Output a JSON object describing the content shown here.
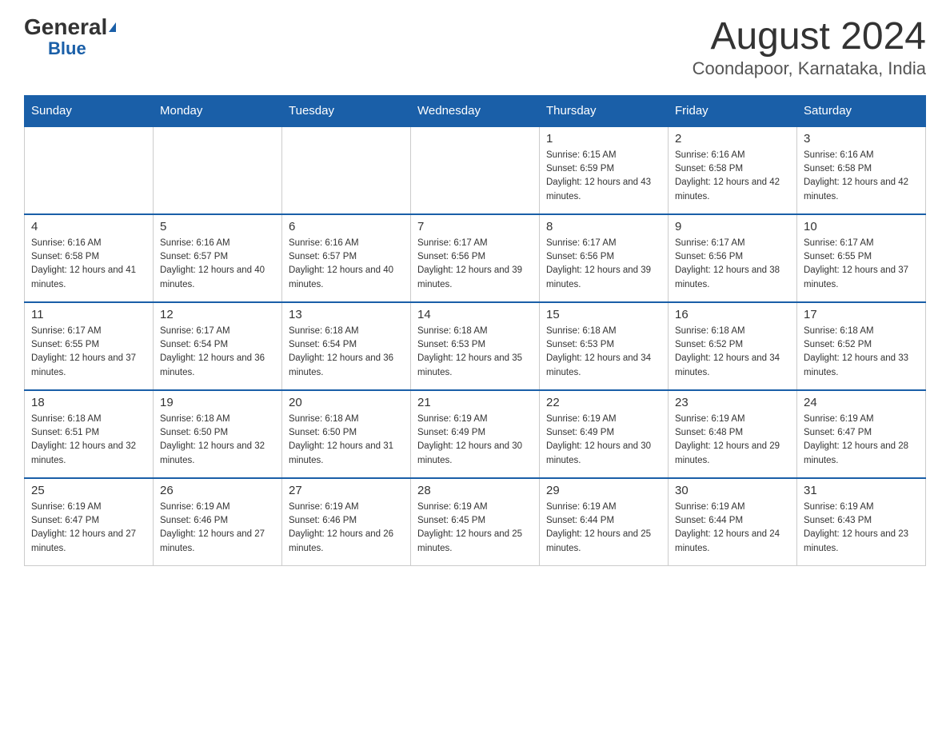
{
  "logo": {
    "general": "General",
    "triangle": "",
    "blue": "Blue"
  },
  "title": "August 2024",
  "subtitle": "Coondapoor, Karnataka, India",
  "days_of_week": [
    "Sunday",
    "Monday",
    "Tuesday",
    "Wednesday",
    "Thursday",
    "Friday",
    "Saturday"
  ],
  "weeks": [
    [
      {
        "day": "",
        "sunrise": "",
        "sunset": "",
        "daylight": ""
      },
      {
        "day": "",
        "sunrise": "",
        "sunset": "",
        "daylight": ""
      },
      {
        "day": "",
        "sunrise": "",
        "sunset": "",
        "daylight": ""
      },
      {
        "day": "",
        "sunrise": "",
        "sunset": "",
        "daylight": ""
      },
      {
        "day": "1",
        "sunrise": "Sunrise: 6:15 AM",
        "sunset": "Sunset: 6:59 PM",
        "daylight": "Daylight: 12 hours and 43 minutes."
      },
      {
        "day": "2",
        "sunrise": "Sunrise: 6:16 AM",
        "sunset": "Sunset: 6:58 PM",
        "daylight": "Daylight: 12 hours and 42 minutes."
      },
      {
        "day": "3",
        "sunrise": "Sunrise: 6:16 AM",
        "sunset": "Sunset: 6:58 PM",
        "daylight": "Daylight: 12 hours and 42 minutes."
      }
    ],
    [
      {
        "day": "4",
        "sunrise": "Sunrise: 6:16 AM",
        "sunset": "Sunset: 6:58 PM",
        "daylight": "Daylight: 12 hours and 41 minutes."
      },
      {
        "day": "5",
        "sunrise": "Sunrise: 6:16 AM",
        "sunset": "Sunset: 6:57 PM",
        "daylight": "Daylight: 12 hours and 40 minutes."
      },
      {
        "day": "6",
        "sunrise": "Sunrise: 6:16 AM",
        "sunset": "Sunset: 6:57 PM",
        "daylight": "Daylight: 12 hours and 40 minutes."
      },
      {
        "day": "7",
        "sunrise": "Sunrise: 6:17 AM",
        "sunset": "Sunset: 6:56 PM",
        "daylight": "Daylight: 12 hours and 39 minutes."
      },
      {
        "day": "8",
        "sunrise": "Sunrise: 6:17 AM",
        "sunset": "Sunset: 6:56 PM",
        "daylight": "Daylight: 12 hours and 39 minutes."
      },
      {
        "day": "9",
        "sunrise": "Sunrise: 6:17 AM",
        "sunset": "Sunset: 6:56 PM",
        "daylight": "Daylight: 12 hours and 38 minutes."
      },
      {
        "day": "10",
        "sunrise": "Sunrise: 6:17 AM",
        "sunset": "Sunset: 6:55 PM",
        "daylight": "Daylight: 12 hours and 37 minutes."
      }
    ],
    [
      {
        "day": "11",
        "sunrise": "Sunrise: 6:17 AM",
        "sunset": "Sunset: 6:55 PM",
        "daylight": "Daylight: 12 hours and 37 minutes."
      },
      {
        "day": "12",
        "sunrise": "Sunrise: 6:17 AM",
        "sunset": "Sunset: 6:54 PM",
        "daylight": "Daylight: 12 hours and 36 minutes."
      },
      {
        "day": "13",
        "sunrise": "Sunrise: 6:18 AM",
        "sunset": "Sunset: 6:54 PM",
        "daylight": "Daylight: 12 hours and 36 minutes."
      },
      {
        "day": "14",
        "sunrise": "Sunrise: 6:18 AM",
        "sunset": "Sunset: 6:53 PM",
        "daylight": "Daylight: 12 hours and 35 minutes."
      },
      {
        "day": "15",
        "sunrise": "Sunrise: 6:18 AM",
        "sunset": "Sunset: 6:53 PM",
        "daylight": "Daylight: 12 hours and 34 minutes."
      },
      {
        "day": "16",
        "sunrise": "Sunrise: 6:18 AM",
        "sunset": "Sunset: 6:52 PM",
        "daylight": "Daylight: 12 hours and 34 minutes."
      },
      {
        "day": "17",
        "sunrise": "Sunrise: 6:18 AM",
        "sunset": "Sunset: 6:52 PM",
        "daylight": "Daylight: 12 hours and 33 minutes."
      }
    ],
    [
      {
        "day": "18",
        "sunrise": "Sunrise: 6:18 AM",
        "sunset": "Sunset: 6:51 PM",
        "daylight": "Daylight: 12 hours and 32 minutes."
      },
      {
        "day": "19",
        "sunrise": "Sunrise: 6:18 AM",
        "sunset": "Sunset: 6:50 PM",
        "daylight": "Daylight: 12 hours and 32 minutes."
      },
      {
        "day": "20",
        "sunrise": "Sunrise: 6:18 AM",
        "sunset": "Sunset: 6:50 PM",
        "daylight": "Daylight: 12 hours and 31 minutes."
      },
      {
        "day": "21",
        "sunrise": "Sunrise: 6:19 AM",
        "sunset": "Sunset: 6:49 PM",
        "daylight": "Daylight: 12 hours and 30 minutes."
      },
      {
        "day": "22",
        "sunrise": "Sunrise: 6:19 AM",
        "sunset": "Sunset: 6:49 PM",
        "daylight": "Daylight: 12 hours and 30 minutes."
      },
      {
        "day": "23",
        "sunrise": "Sunrise: 6:19 AM",
        "sunset": "Sunset: 6:48 PM",
        "daylight": "Daylight: 12 hours and 29 minutes."
      },
      {
        "day": "24",
        "sunrise": "Sunrise: 6:19 AM",
        "sunset": "Sunset: 6:47 PM",
        "daylight": "Daylight: 12 hours and 28 minutes."
      }
    ],
    [
      {
        "day": "25",
        "sunrise": "Sunrise: 6:19 AM",
        "sunset": "Sunset: 6:47 PM",
        "daylight": "Daylight: 12 hours and 27 minutes."
      },
      {
        "day": "26",
        "sunrise": "Sunrise: 6:19 AM",
        "sunset": "Sunset: 6:46 PM",
        "daylight": "Daylight: 12 hours and 27 minutes."
      },
      {
        "day": "27",
        "sunrise": "Sunrise: 6:19 AM",
        "sunset": "Sunset: 6:46 PM",
        "daylight": "Daylight: 12 hours and 26 minutes."
      },
      {
        "day": "28",
        "sunrise": "Sunrise: 6:19 AM",
        "sunset": "Sunset: 6:45 PM",
        "daylight": "Daylight: 12 hours and 25 minutes."
      },
      {
        "day": "29",
        "sunrise": "Sunrise: 6:19 AM",
        "sunset": "Sunset: 6:44 PM",
        "daylight": "Daylight: 12 hours and 25 minutes."
      },
      {
        "day": "30",
        "sunrise": "Sunrise: 6:19 AM",
        "sunset": "Sunset: 6:44 PM",
        "daylight": "Daylight: 12 hours and 24 minutes."
      },
      {
        "day": "31",
        "sunrise": "Sunrise: 6:19 AM",
        "sunset": "Sunset: 6:43 PM",
        "daylight": "Daylight: 12 hours and 23 minutes."
      }
    ]
  ]
}
